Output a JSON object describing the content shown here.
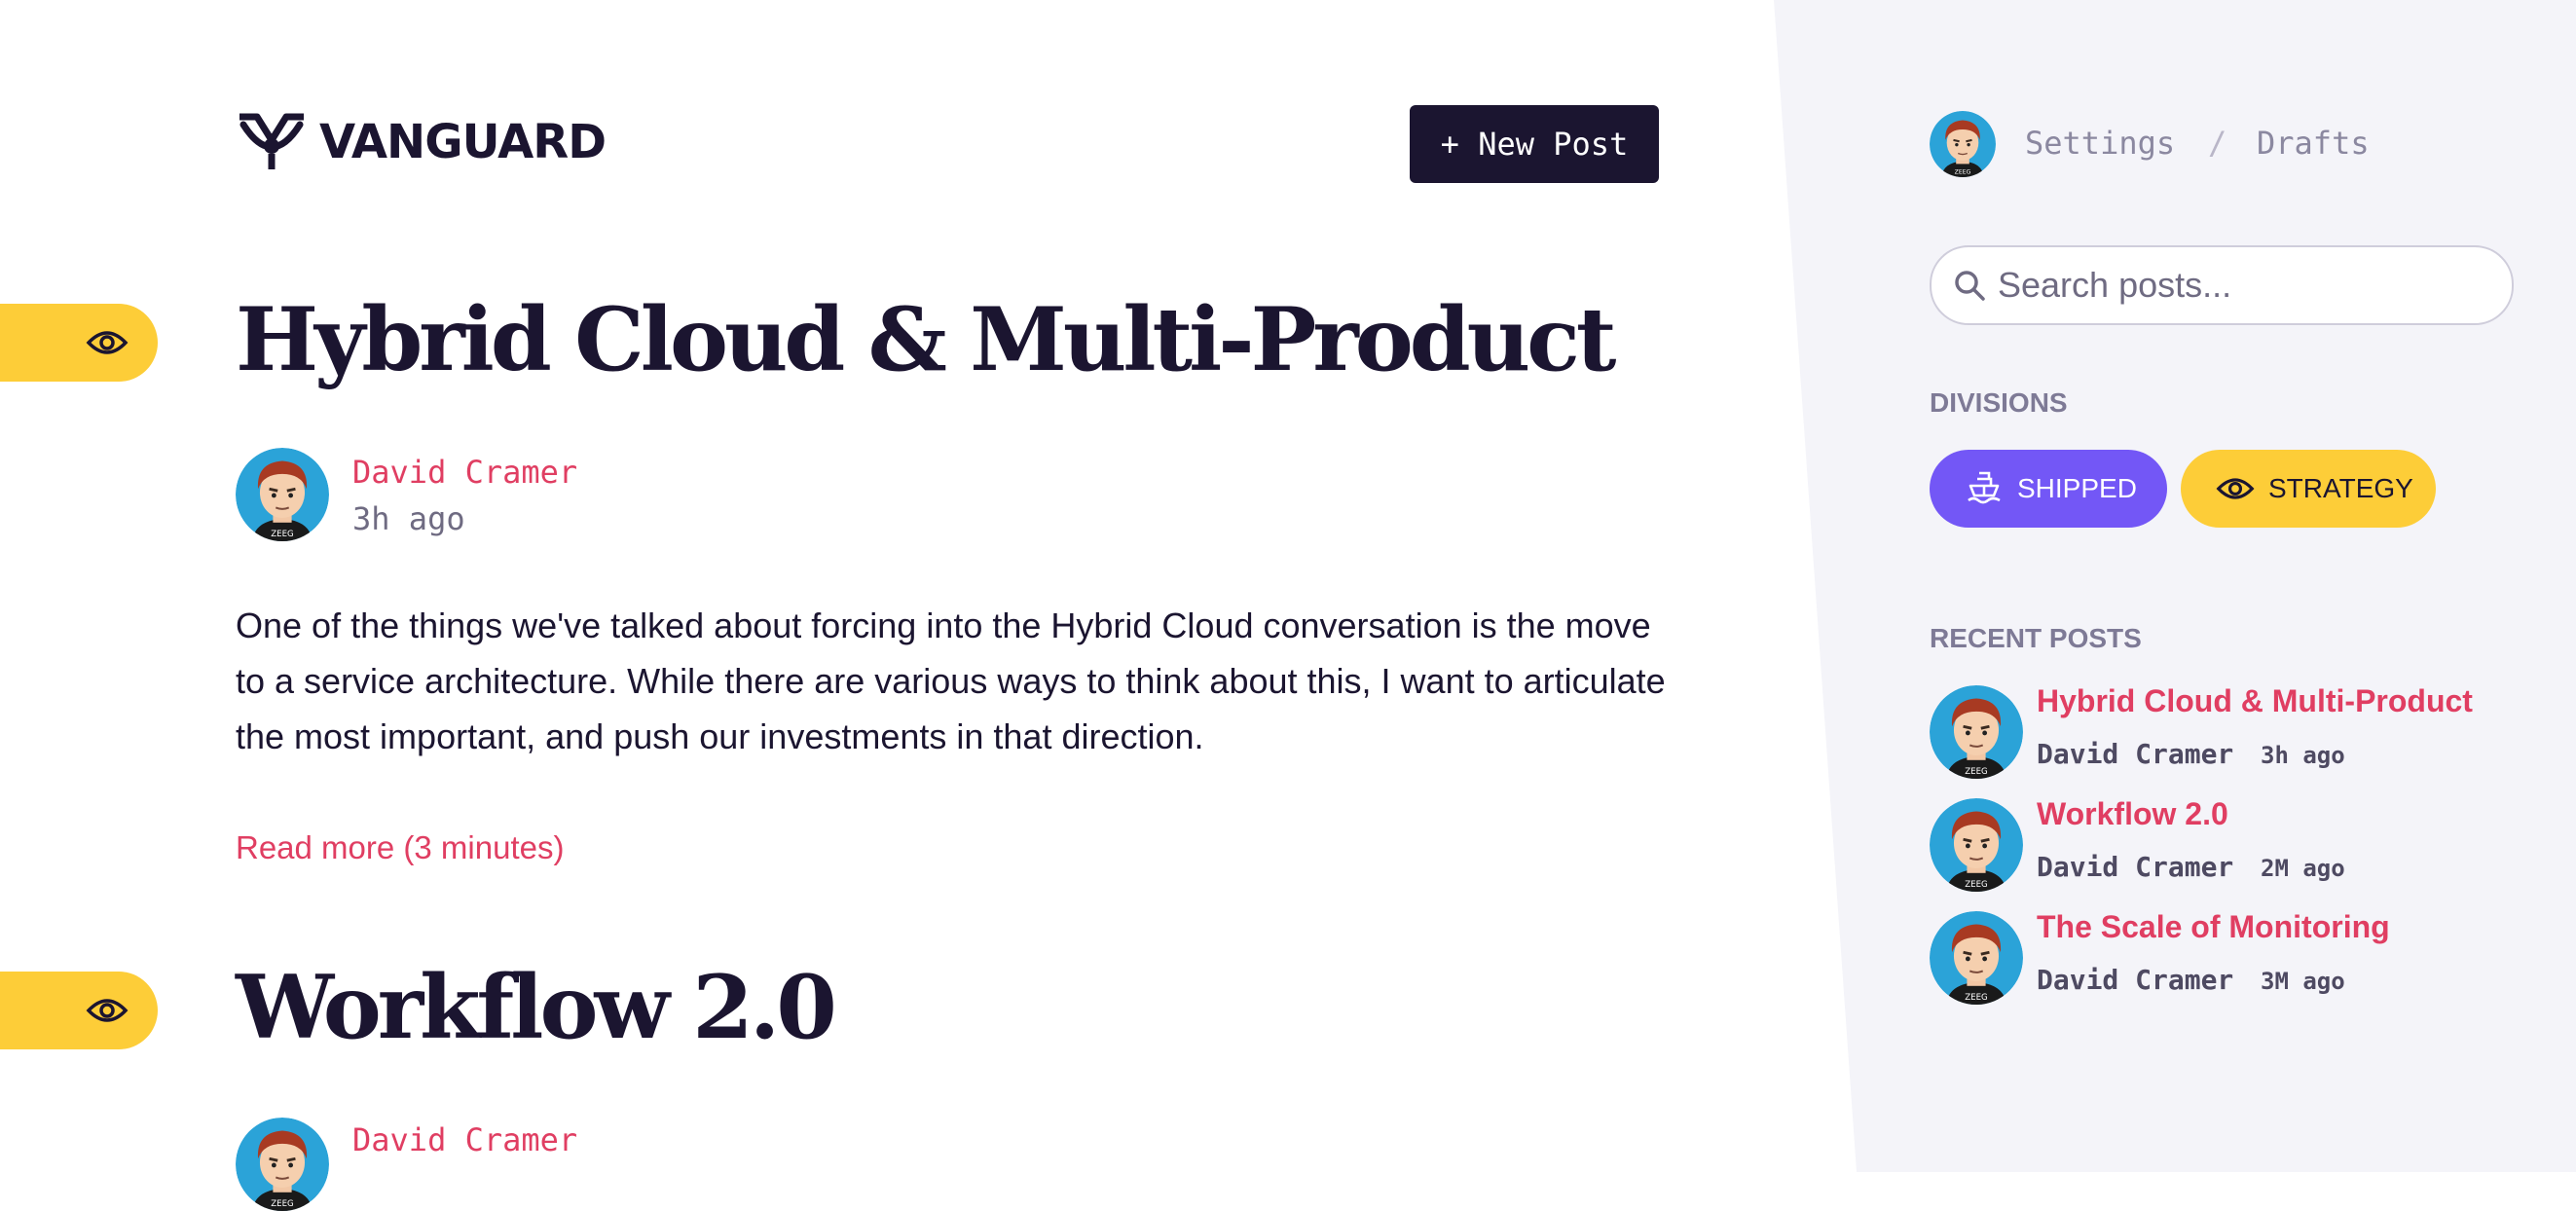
{
  "brand": {
    "name": "VANGUARD",
    "logo_icon": "vanguard-logo-icon"
  },
  "header": {
    "new_post_label": "+ New Post"
  },
  "posts": [
    {
      "title": "Hybrid Cloud & Multi-Product",
      "author": "David Cramer",
      "time": "3h ago",
      "division_icon": "eye-icon",
      "excerpt": "One of the things we've talked about forcing into the Hybrid Cloud conversation is the move to a service architecture. While there are various ways to think about this, I want to articulate the most important, and push our investments in that direction.",
      "read_more": "Read more (3 minutes)"
    },
    {
      "title": "Workflow 2.0",
      "author": "David Cramer",
      "division_icon": "eye-icon"
    }
  ],
  "sidebar": {
    "nav": {
      "settings": "Settings",
      "separator": "/",
      "drafts": "Drafts"
    },
    "search": {
      "placeholder": "Search posts..."
    },
    "divisions_heading": "DIVISIONS",
    "divisions": [
      {
        "label": "SHIPPED",
        "icon": "ship-icon",
        "color": "#7357f6"
      },
      {
        "label": "STRATEGY",
        "icon": "eye-icon",
        "color": "#fdcd38"
      }
    ],
    "recent_heading": "RECENT POSTS",
    "recent_posts": [
      {
        "title": "Hybrid Cloud & Multi-Product",
        "author": "David Cramer",
        "time": "3h ago"
      },
      {
        "title": "Workflow 2.0",
        "author": "David Cramer",
        "time": "2M ago"
      },
      {
        "title": "The Scale of Monitoring",
        "author": "David Cramer",
        "time": "3M ago"
      }
    ]
  },
  "colors": {
    "accent": "#e03e62",
    "dark": "#1b1530",
    "yellow": "#fdcd38",
    "purple": "#7357f6",
    "sidebar_bg": "#f4f4f9"
  }
}
